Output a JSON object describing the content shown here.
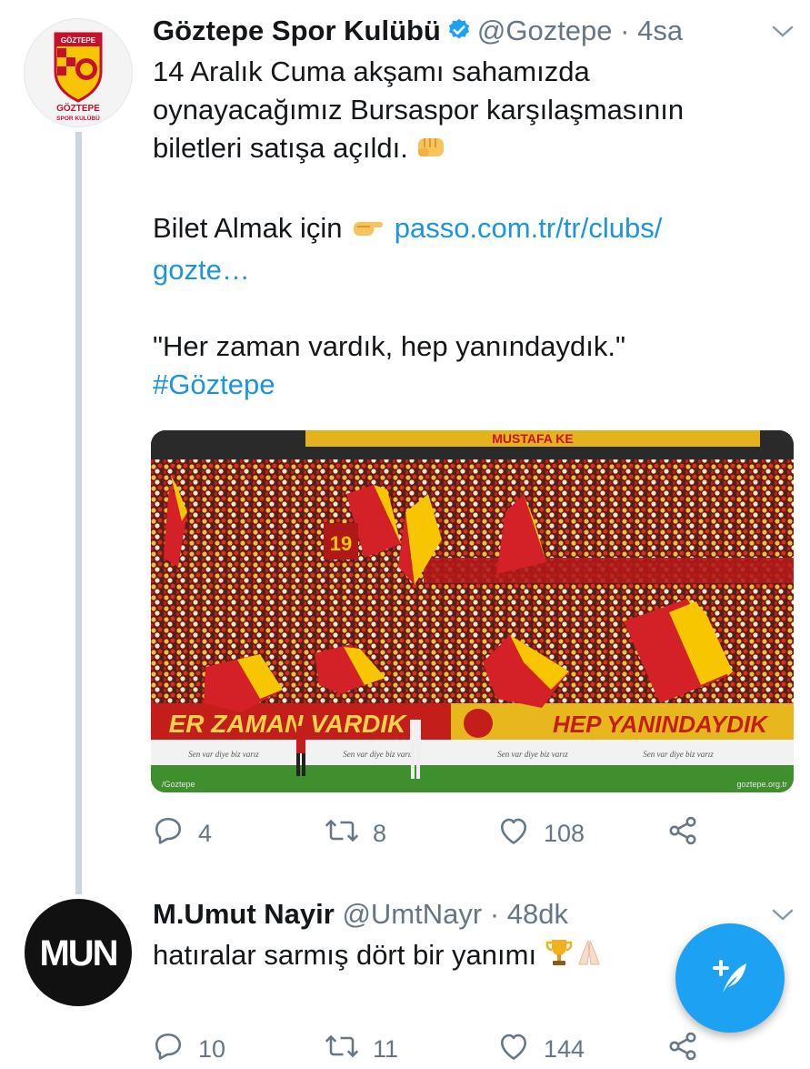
{
  "tweet1": {
    "author_name": "Göztepe Spor Kulübü",
    "handle": "@Goztepe",
    "separator": "·",
    "time": "4sa",
    "avatar_text_line1": "GÖZTEPE",
    "avatar_text_line2": "SPOR KULÜBÜ",
    "avatar_banner": "GÖZTEPE",
    "text_line1": "14 Aralık Cuma akşamı sahamızda",
    "text_line2": "oynayacağımız Bursaspor karşılaşmasının",
    "text_line3": "biletleri satışa açıldı.",
    "text_line4": "Bilet Almak için",
    "link_part1": "passo.com.tr/tr/clubs/",
    "link_part2": "gozte…",
    "quote": "\"Her zaman vardık, hep yanındaydık.\"",
    "hashtag": "#Göztepe",
    "media": {
      "banner_left": "ER ZAMAN VARDIK",
      "banner_right": "HEP YANINDAYDIK",
      "ad_text": "Sen var diye biz varız",
      "flag_number": "19",
      "watermark_left": "/Goztepe",
      "watermark_right": "goztepe.org.tr",
      "top_banner": "MUSTAFA KE"
    },
    "replies": "4",
    "retweets": "8",
    "likes": "108"
  },
  "tweet2": {
    "author_name": "M.Umut Nayir",
    "handle": "@UmtNayr",
    "separator": "·",
    "time": "48dk",
    "avatar_text": "MUN",
    "text": "hatıralar sarmış dört bir yanımı",
    "replies": "10",
    "retweets": "11",
    "likes": "144"
  },
  "colors": {
    "accent": "#1da1f2",
    "link": "#1b95e0",
    "muted": "#657786",
    "thread_line": "#cdd6dd",
    "club_red": "#d42027",
    "club_yellow": "#f7c600"
  },
  "icons": [
    "verified-icon",
    "chevron-down-icon",
    "reply-icon",
    "retweet-icon",
    "like-icon",
    "share-icon",
    "compose-icon",
    "fist-emoji",
    "pointing-emoji",
    "trophy-emoji",
    "folded-hands-emoji"
  ]
}
